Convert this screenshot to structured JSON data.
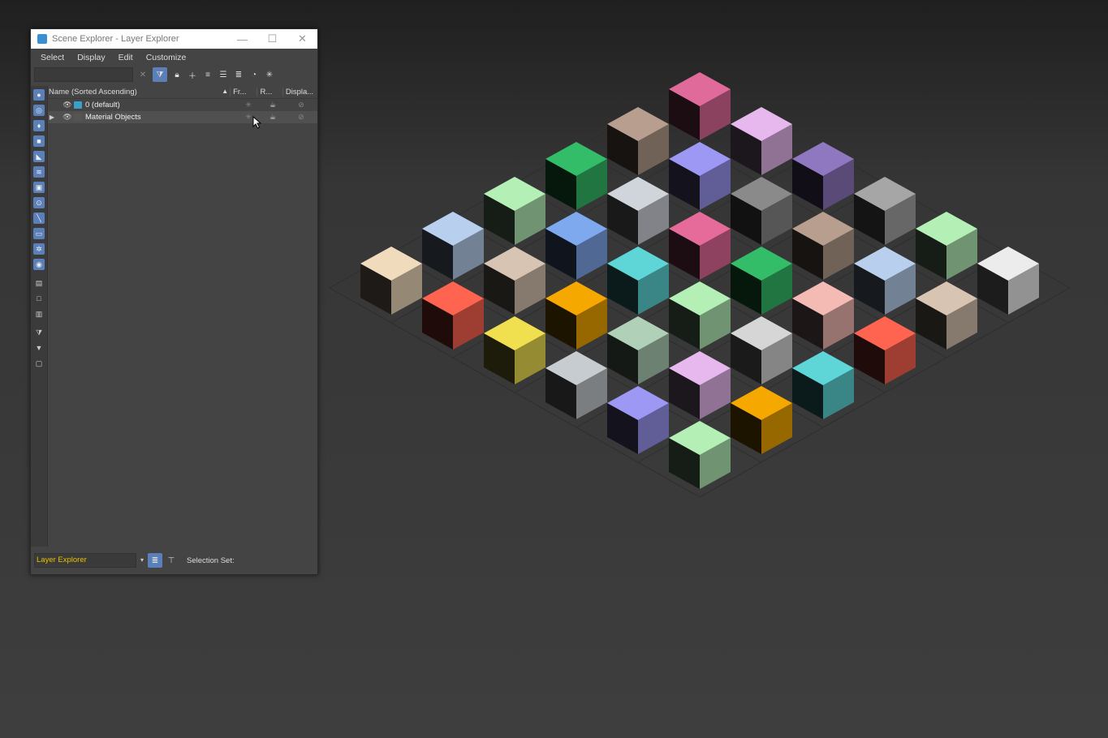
{
  "window": {
    "title": "Scene Explorer - Layer Explorer",
    "minimize_glyph": "—",
    "maximize_glyph": "☐",
    "close_glyph": "✕"
  },
  "menu": [
    "Select",
    "Display",
    "Edit",
    "Customize"
  ],
  "toolbar": {
    "search_value": "",
    "clear_glyph": "✕",
    "icons": [
      "filter-toggle-icon",
      "lock-icon",
      "new-layer-icon",
      "add-to-layer-icon",
      "select-layer-objects-icon",
      "layer-stack-icon",
      "hide-icon",
      "freeze-icon"
    ]
  },
  "columns": {
    "name": "Name (Sorted Ascending)",
    "sort_glyph": "▲",
    "frozen": "Fr...",
    "renderable": "R...",
    "display": "Displa..."
  },
  "layers": [
    {
      "name": "0 (default)",
      "expandable": false
    },
    {
      "name": "Material Objects",
      "expandable": true
    }
  ],
  "left_icons": [
    "geometry-icon",
    "shapes-icon",
    "lights-icon",
    "cameras-icon",
    "helpers-icon",
    "spacewarps-icon",
    "groups-icon",
    "xrefs-icon",
    "bones-icon",
    "containers-icon",
    "frozen-icon",
    "hidden-icon",
    "all-icon",
    "none-icon",
    "invert-icon",
    "filter-icon",
    "filter-funnel-icon",
    "sync-icon"
  ],
  "status": {
    "explorer": "Layer Explorer",
    "selection_set_label": "Selection Set:"
  },
  "scene": {
    "cube_colors": [
      "#e06b9a",
      "#b79e8e",
      "#34bd68",
      "#b4efb6",
      "#b8d0ee",
      "#f0dcbd",
      "#e7b8ee",
      "#9c98f3",
      "#d0d4db",
      "#7fa9ee",
      "#d8c4b2",
      "#ff6450",
      "#9078c0",
      "#8a8a8a",
      "#e66b9a",
      "#5ed6d8",
      "#f5a800",
      "#f0e050",
      "#a6a6a6",
      "#b79e8e",
      "#34bd68",
      "#b4efb6",
      "#b0d0b8",
      "#c6ccd0",
      "#b4efb6",
      "#b8d0ee",
      "#f4bab4",
      "#d6d6d6",
      "#e7b8ee",
      "#9c98f3",
      "#ececec",
      "#d8c4b2",
      "#ff6450",
      "#5ed6d8",
      "#f5a800",
      "#b4efb6"
    ]
  }
}
